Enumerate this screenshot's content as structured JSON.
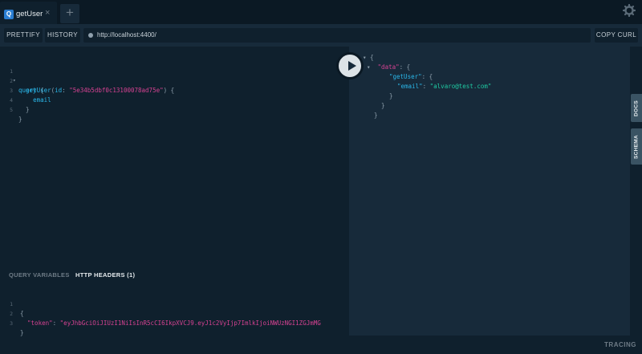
{
  "tabs": [
    {
      "badge": "Q",
      "label": "getUser",
      "close": "×"
    }
  ],
  "add_tab_label": "+",
  "toolbar": {
    "prettify": "PRETTIFY",
    "history": "HISTORY",
    "url": "http://localhost:4400/",
    "copy_curl": "COPY CURL"
  },
  "query_editor": {
    "line_numbers": [
      "1",
      "2",
      "3",
      "4",
      "5"
    ],
    "keyword": "query",
    "open_brace": "{",
    "field": "getUser",
    "arg_name": "id",
    "arg_value": "\"5e34b5dbf0c13100078ad75e\"",
    "subfield": "email",
    "close_inner": "}",
    "close_outer": "}"
  },
  "result": {
    "data_key": "\"data\"",
    "getuser_key": "\"getUser\"",
    "email_key": "\"email\"",
    "email_value": "\"alvaro@test.com\""
  },
  "side_tabs": {
    "docs": "DOCS",
    "schema": "SCHEMA"
  },
  "variables_panel": {
    "query_variables": "QUERY VARIABLES",
    "http_headers": "HTTP HEADERS (1)",
    "line_numbers": [
      "1",
      "2",
      "3"
    ],
    "token_key": "\"token\"",
    "token_value": "\"eyJhbGciOiJIUzI1NiIsInR5cCI6IkpXVCJ9.eyJ1c2VyIjp7ImlkIjoiNWUzNGI1ZGJmMG"
  },
  "tracing": "TRACING",
  "icons": {
    "gear": "gear-icon",
    "play": "play-icon",
    "status_dot": "status-dot-icon"
  },
  "colors": {
    "accent": "#2a7ed2",
    "keyword": "#2ab6e8",
    "string": "#d64292",
    "result_string": "#1fc9a2"
  }
}
